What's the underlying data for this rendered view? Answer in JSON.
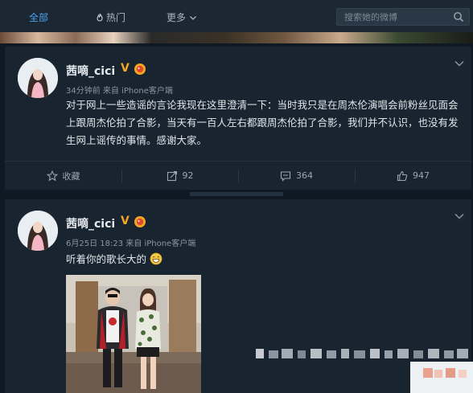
{
  "nav": {
    "tab_all": "全部",
    "tab_hot": "热门",
    "tab_more": "更多",
    "search_placeholder": "搜索她的微博"
  },
  "posts": [
    {
      "username": "茜嘀_cici",
      "verified_badge": "V",
      "time": "34分钟前",
      "source": "来自 iPhone客户端",
      "text": "对于网上一些造谣的言论我现在这里澄清一下：当时我只是在周杰伦演唱会前粉丝见面会上跟周杰伦拍了合影，当天有一百人左右都跟周杰伦拍了合影，我们并不认识，也没有发生网上谣传的事情。感谢大家。",
      "actions": {
        "favorite": "收藏",
        "repost": "92",
        "comment": "364",
        "like": "947"
      }
    },
    {
      "username": "茜嘀_cici",
      "verified_badge": "V",
      "time": "6月25日 18:23",
      "source": "来自 iPhone客户端",
      "text": "听着你的歌长大的",
      "emoji": "grinning-emoji"
    }
  ],
  "icons": {
    "hot": "fire-icon",
    "more": "chevron-down-icon",
    "search": "search-icon",
    "favorite": "star-icon",
    "repost": "repost-icon",
    "comment": "comment-icon",
    "like": "thumbs-up-icon"
  },
  "colors": {
    "background": "#0f1924",
    "card": "#18242f",
    "accent_blue": "#4da3ef",
    "verified": "#f5a623"
  }
}
